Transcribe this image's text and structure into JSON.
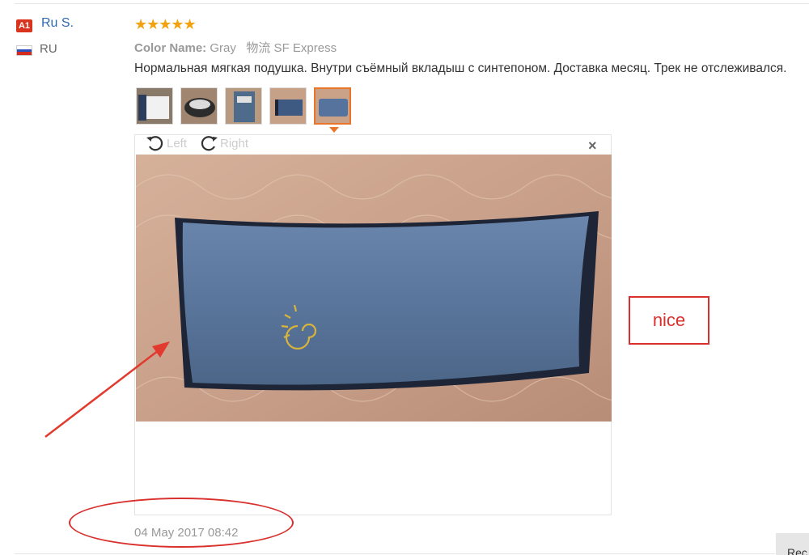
{
  "user": {
    "badge": "A1",
    "name": "Ru S.",
    "country": "RU"
  },
  "review": {
    "stars": "★★★★★",
    "color_label": "Color Name:",
    "color_value": " Gray",
    "logistics": "物流 SF Express",
    "text": "Нормальная мягкая подушка. Внутри съёмный вкладыш с синтепоном. Доставка месяц. Трек не отслеживался.",
    "date": "04 May 2017 08:42"
  },
  "viewer": {
    "rotate_left": "Left",
    "rotate_right": "Right",
    "close": "×"
  },
  "annotation": {
    "note": "nice"
  },
  "actions": {
    "report": "Rec"
  },
  "colors": {
    "accent": "#e8752a",
    "annotation": "#d9302d",
    "link": "#2f6bb3",
    "star": "#f2a20c"
  }
}
